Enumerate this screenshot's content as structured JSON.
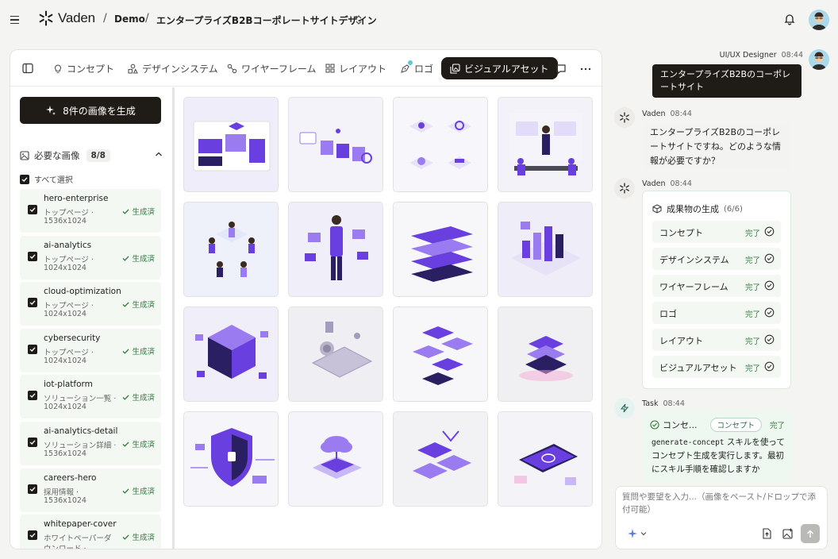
{
  "topbar": {
    "logo_text": "Vaden",
    "breadcrumb": [
      "Demo",
      "エンタープライズB2Bコーポレートサイトデザイン"
    ]
  },
  "tabs": [
    {
      "label": "コンセプト",
      "icon": "lightbulb-icon"
    },
    {
      "label": "デザインシステム",
      "icon": "shapes-icon"
    },
    {
      "label": "ワイヤーフレーム",
      "icon": "wireframe-icon"
    },
    {
      "label": "レイアウト",
      "icon": "layout-grid-icon"
    },
    {
      "label": "ロゴ",
      "icon": "pen-tool-icon"
    },
    {
      "label": "ビジュアルアセット",
      "icon": "images-icon",
      "active": true
    }
  ],
  "left": {
    "generate_button": "8件の画像を生成",
    "required_label": "必要な画像",
    "required_count": "8/8",
    "select_all": "すべて選択",
    "images": [
      {
        "name": "hero-enterprise",
        "meta1": "トップページ ·",
        "meta2": "1536x1024",
        "status": "生成済"
      },
      {
        "name": "ai-analytics",
        "meta1": "トップページ ·",
        "meta2": "1024x1024",
        "status": "生成済"
      },
      {
        "name": "cloud-optimization",
        "meta1": "トップページ ·",
        "meta2": "1024x1024",
        "status": "生成済"
      },
      {
        "name": "cybersecurity",
        "meta1": "トップページ ·",
        "meta2": "1024x1024",
        "status": "生成済"
      },
      {
        "name": "iot-platform",
        "meta1": "ソリューション一覧 ·",
        "meta2": "1024x1024",
        "status": "生成済"
      },
      {
        "name": "ai-analytics-detail",
        "meta1": "ソリューション詳細 ·",
        "meta2": "1536x1024",
        "status": "生成済"
      },
      {
        "name": "careers-hero",
        "meta1": "採用情報 ·",
        "meta2": "1536x1024",
        "status": "生成済"
      },
      {
        "name": "whitepaper-cover",
        "meta1": "ホワイトペーパーダ",
        "meta2": "ウンロード ·",
        "status": "生成済"
      }
    ]
  },
  "chat": {
    "user_name": "UI/UX Designer",
    "user_time": "08:44",
    "user_message": "エンタープライズB2Bのコーポレートサイト",
    "bot_name": "Vaden",
    "bot_time_1": "08:44",
    "bot_message_1": "エンタープライズB2Bのコーポレートサイトですね。どのような情報が必要ですか？",
    "bot_time_2": "08:44",
    "deliverables_title": "成果物の生成",
    "deliverables_count": "(6/6)",
    "deliverables": [
      {
        "label": "コンセプト",
        "status": "完了"
      },
      {
        "label": "デザインシステム",
        "status": "完了"
      },
      {
        "label": "ワイヤーフレーム",
        "status": "完了"
      },
      {
        "label": "ロゴ",
        "status": "完了"
      },
      {
        "label": "レイアウト",
        "status": "完了"
      },
      {
        "label": "ビジュアルアセット",
        "status": "完了"
      }
    ],
    "task_name": "Task",
    "task_time": "08:44",
    "task_title": "コンセ...",
    "task_chip": "コンセプト",
    "task_status": "完了",
    "task_code": "generate-concept",
    "task_text_1": " スキルを使ってコンセプト生成を実行します。最初にスキル手順を確認しますか"
  },
  "composer": {
    "placeholder": "質問や要望を入力...（画像をペースト/ドロップで添付可能）"
  },
  "colors": {
    "primary_dark": "#1f1b17",
    "success_green": "#2f7d3a",
    "accent_purple": "#6a3fe0"
  }
}
